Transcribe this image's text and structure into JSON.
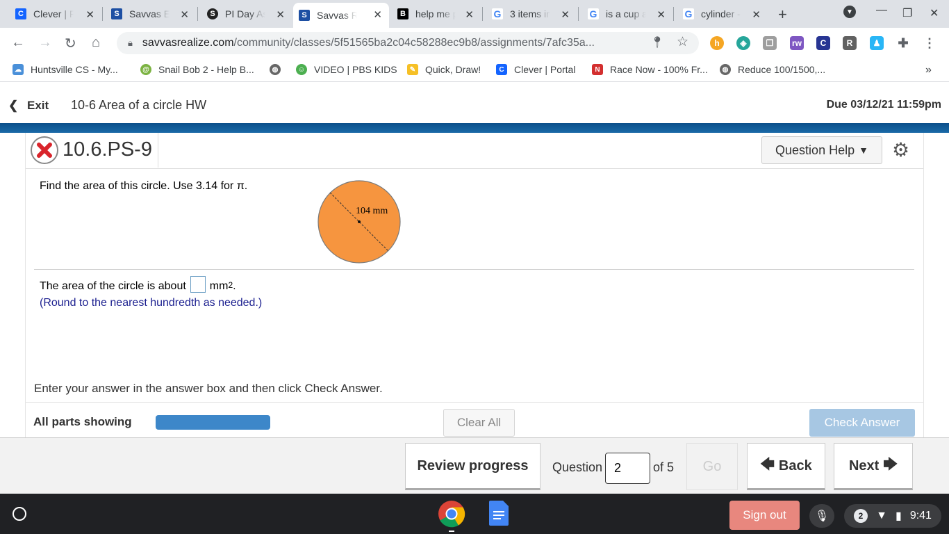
{
  "browser": {
    "tabs": [
      {
        "title": "Clever | P",
        "icon": "clever-icon",
        "color": "#1464ff",
        "glyph": "C"
      },
      {
        "title": "Savvas E",
        "icon": "savvas-icon",
        "color": "#1d4fa3",
        "glyph": "S"
      },
      {
        "title": "PI Day As",
        "icon": "sketchy-icon",
        "color": "#222222",
        "glyph": "S"
      },
      {
        "title": "Savvas R",
        "icon": "savvas-icon",
        "color": "#1d4fa3",
        "glyph": "S"
      },
      {
        "title": "help me p",
        "icon": "brainly-icon",
        "color": "#000000",
        "glyph": "B"
      },
      {
        "title": "3 items in",
        "icon": "google-icon",
        "color": "#4285f4",
        "glyph": "G"
      },
      {
        "title": "is a cup a",
        "icon": "google-icon",
        "color": "#4285f4",
        "glyph": "G"
      },
      {
        "title": "cylinder -",
        "icon": "google-icon",
        "color": "#4285f4",
        "glyph": "G"
      }
    ],
    "url_host": "savvasrealize.com",
    "url_path": "/community/classes/5f51565ba2c04c58288ec9b8/assignments/7afc35a...",
    "bookmarks": [
      {
        "label": "Huntsville CS - My...",
        "color": "#4a90d9"
      },
      {
        "label": "Snail Bob 2 - Help B...",
        "color": "#7cb342"
      },
      {
        "label": "",
        "color": "#666666"
      },
      {
        "label": "VIDEO | PBS KIDS",
        "color": "#4caf50"
      },
      {
        "label": "Quick, Draw!",
        "color": "#f6c026"
      },
      {
        "label": "Clever | Portal",
        "color": "#1464ff"
      },
      {
        "label": "Race Now - 100% Fr...",
        "color": "#d32f2f"
      },
      {
        "label": "Reduce 100/1500,...",
        "color": "#666666"
      }
    ],
    "more_bookmarks": "»"
  },
  "header": {
    "exit_label": "Exit",
    "assignment_title": "10-6 Area of a circle HW",
    "due": "Due 03/12/21 11:59pm"
  },
  "question": {
    "id": "10.6.PS-9",
    "help_label": "Question Help",
    "prompt": "Find the area of this circle. Use 3.14 for π.",
    "diagram_label": "104 mm",
    "answer_prefix": "The area of the circle is about",
    "answer_unit": "mm",
    "answer_exp": "2",
    "answer_suffix": ".",
    "round_note": "(Round to the nearest hundredth as needed.)",
    "instruction": "Enter your answer in the answer box and then click Check Answer.",
    "parts_label": "All parts showing",
    "clear_label": "Clear All",
    "check_label": "Check Answer",
    "progress_fraction": 1.0
  },
  "nav": {
    "review_label": "Review progress",
    "question_label": "Question",
    "question_number": "2",
    "of_label": "of 5",
    "go_label": "Go",
    "back_label": "Back",
    "next_label": "Next"
  },
  "shelf": {
    "signout_label": "Sign out",
    "notifications": "2",
    "time": "9:41"
  },
  "colors": {
    "circle_fill": "#f6953f",
    "brand_band": "#0b4f8a",
    "progress": "#3d87c9"
  }
}
